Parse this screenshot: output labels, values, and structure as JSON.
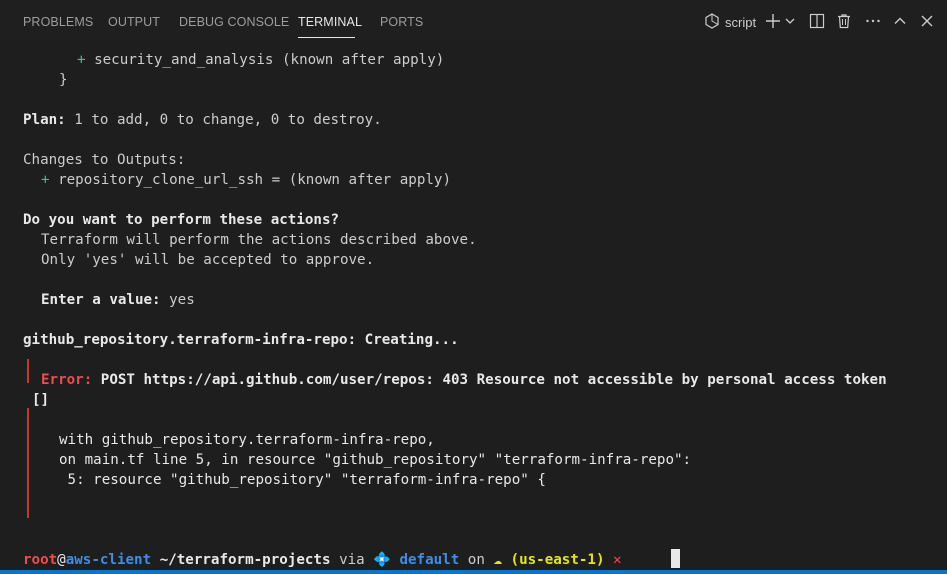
{
  "panel": {
    "tabs": [
      {
        "label": "PROBLEMS"
      },
      {
        "label": "OUTPUT"
      },
      {
        "label": "DEBUG CONSOLE"
      },
      {
        "label": "TERMINAL"
      },
      {
        "label": "PORTS"
      }
    ],
    "active_tab": "TERMINAL",
    "terminal_name": "script"
  },
  "terminal": {
    "l1_plus": "+",
    "l1_text": "security_and_analysis (known after apply)",
    "l2": "}",
    "plan_label": "Plan:",
    "plan_text": " 1 to add, 0 to change, 0 to destroy.",
    "outputs_header": "Changes to Outputs:",
    "outputs_plus": "+",
    "outputs_text": "repository_clone_url_ssh = (known after apply)",
    "prompt_q": "Do you want to perform these actions?",
    "prompt_l1": "Terraform will perform the actions described above.",
    "prompt_l2": "Only 'yes' will be accepted to approve.",
    "enter_label": "Enter a value:",
    "enter_value": " yes",
    "creating": "github_repository.terraform-infra-repo: Creating...",
    "error_label": "Error:",
    "error_text": " POST https://api.github.com/user/repos: 403 Resource not accessible by personal access token",
    "error_tail": "[]",
    "with_line": "with github_repository.terraform-infra-repo,",
    "on_line": "on main.tf line 5, in resource \"github_repository\" \"terraform-infra-repo\":",
    "code_line": " 5: resource \"github_repository\" \"terraform-infra-repo\" {",
    "ps_user": "root",
    "ps_at": "@",
    "ps_host": "aws-client",
    "ps_path": "~/terraform-projects",
    "ps_via": " via ",
    "ps_tf_icon": "💠",
    "ps_ws": "default",
    "ps_on": " on ",
    "ps_cloud_icon": "☁",
    "ps_region": "(us-east-1)",
    "ps_status": "✕"
  },
  "colors": {
    "background": "#1e1e1e",
    "green": "#23d18b",
    "red": "#f14c4c",
    "blue": "#3b8eea",
    "yellow": "#e5e510",
    "accent": "#0078d4"
  }
}
